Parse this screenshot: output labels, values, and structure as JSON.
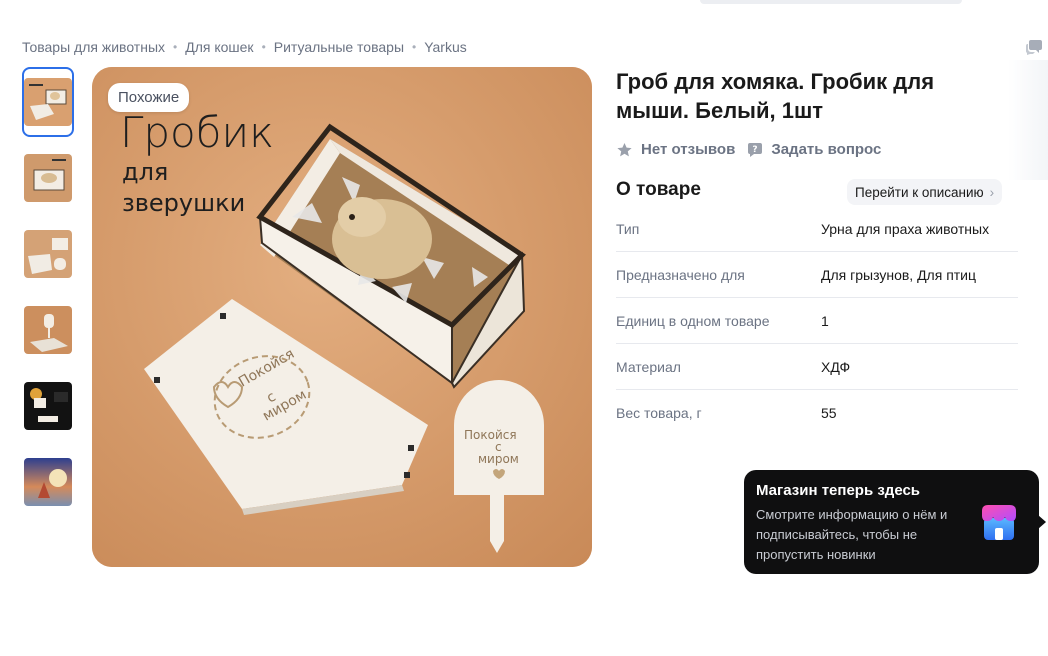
{
  "breadcrumb": [
    "Товары для животных",
    "Для кошек",
    "Ритуальные товары",
    "Yarkus"
  ],
  "breadcrumb_separator": "•",
  "gallery": {
    "thumbnails": [
      "thumb-1",
      "thumb-2",
      "thumb-3",
      "thumb-4",
      "thumb-5",
      "thumb-6"
    ],
    "active_index": 0,
    "similar_label": "Похожие",
    "image_heading": "Гробик",
    "image_subtitle_1": "для",
    "image_subtitle_2": "зверушки",
    "lid_engraving_1": "Покойся",
    "lid_engraving_2": "с",
    "lid_engraving_3": "миром",
    "sign_engraving_1": "Покойся",
    "sign_engraving_2": "с",
    "sign_engraving_3": "миром"
  },
  "product": {
    "title": "Гроб для хомяка. Гробик для мыши. Белый, 1шт",
    "reviews_label": "Нет отзывов",
    "ask_label": "Задать вопрос"
  },
  "about": {
    "heading": "О товаре",
    "description_link": "Перейти к описанию",
    "specs": [
      {
        "key": "Тип",
        "value": "Урна для праха животных"
      },
      {
        "key": "Предназначено для",
        "value": "Для грызунов, Для птиц"
      },
      {
        "key": "Единиц в одном товаре",
        "value": "1"
      },
      {
        "key": "Материал",
        "value": "ХДФ"
      },
      {
        "key": "Вес товара, г",
        "value": "55"
      }
    ]
  },
  "popup": {
    "title": "Магазин теперь здесь",
    "text": "Смотрите информацию о нём и подписывайтесь, чтобы не пропустить новинки"
  },
  "icons": [
    "chat-icon",
    "star-icon",
    "question-icon",
    "chevron-right-icon",
    "shop-icon"
  ],
  "colors": {
    "accent": "#2c6fe8",
    "muted_text": "#6b7383",
    "popup_bg": "#0f0f10",
    "image_bg": "#d9a070"
  }
}
